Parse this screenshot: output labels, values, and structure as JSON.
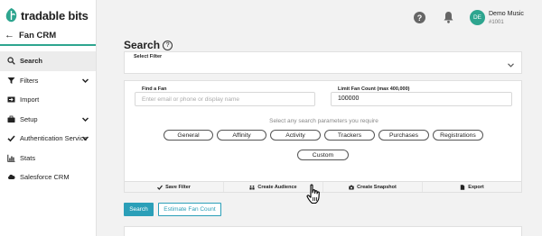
{
  "brand": {
    "name": "tradable bits",
    "accent": "#2ea58f"
  },
  "sidebar": {
    "back_icon": "arrow-left-icon",
    "title": "Fan CRM",
    "items": [
      {
        "label": "Search",
        "icon": "search-icon",
        "active": true,
        "expandable": false
      },
      {
        "label": "Filters",
        "icon": "filter-icon",
        "active": false,
        "expandable": true
      },
      {
        "label": "Import",
        "icon": "import-icon",
        "active": false,
        "expandable": false
      },
      {
        "label": "Setup",
        "icon": "briefcase-icon",
        "active": false,
        "expandable": true
      },
      {
        "label": "Authentication Service",
        "icon": "check-icon",
        "active": false,
        "expandable": true
      },
      {
        "label": "Stats",
        "icon": "chart-icon",
        "active": false,
        "expandable": false
      },
      {
        "label": "Salesforce CRM",
        "icon": "cloud-icon",
        "active": false,
        "expandable": false
      }
    ]
  },
  "topbar": {
    "help_icon": "?",
    "user": {
      "initials": "DE",
      "name": "Demo Music",
      "id": "#1001"
    }
  },
  "page": {
    "title": "Search",
    "title_help": "?"
  },
  "filter": {
    "label": "Select Filter"
  },
  "search": {
    "find_fan_label": "Find a Fan",
    "find_fan_placeholder": "Enter email or phone or display name",
    "limit_label": "Limit Fan Count (max 400,000)",
    "limit_value": "100000",
    "hint": "Select any search parameters you require",
    "params": [
      "General",
      "Affinity",
      "Activity",
      "Trackers",
      "Purchases",
      "Registrations",
      "Custom"
    ]
  },
  "actions": [
    {
      "label": "Save Filter",
      "icon": "check-icon"
    },
    {
      "label": "Create Audience",
      "icon": "audience-icon"
    },
    {
      "label": "Create Snapshot",
      "icon": "camera-icon"
    },
    {
      "label": "Export",
      "icon": "file-icon"
    }
  ],
  "buttons": {
    "search": "Search",
    "estimate": "Estimate Fan Count"
  },
  "colors": {
    "primary_button": "#2b9fb8",
    "accent": "#2ea58f"
  }
}
